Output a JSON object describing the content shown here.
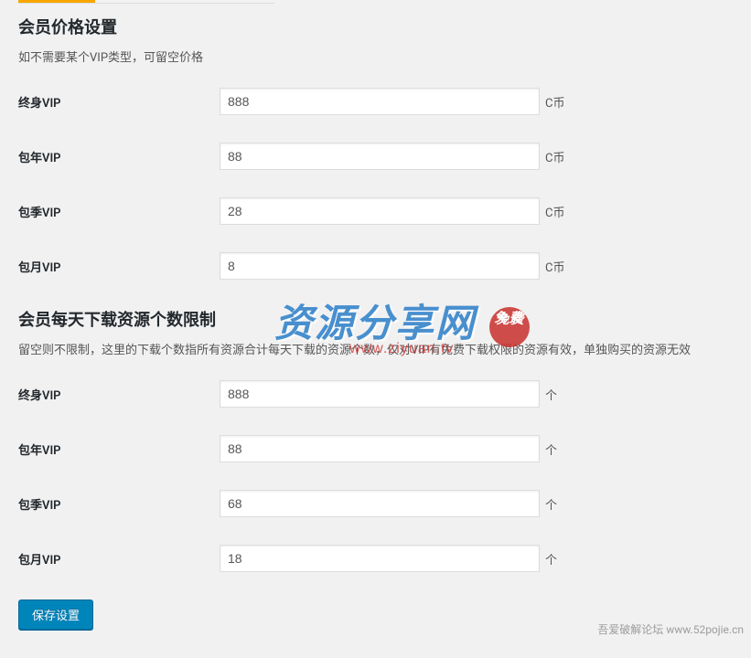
{
  "section1": {
    "title": "会员价格设置",
    "description": "如不需要某个VIP类型，可留空价格",
    "unit": "C币",
    "fields": [
      {
        "label": "终身VIP",
        "value": "888"
      },
      {
        "label": "包年VIP",
        "value": "88"
      },
      {
        "label": "包季VIP",
        "value": "28"
      },
      {
        "label": "包月VIP",
        "value": "8"
      }
    ]
  },
  "section2": {
    "title": "会员每天下载资源个数限制",
    "description": "留空则不限制，这里的下载个数指所有资源合计每天下载的资源个数，仅对VIP有免费下载权限的资源有效，单独购买的资源无效",
    "unit": "个",
    "fields": [
      {
        "label": "终身VIP",
        "value": "888"
      },
      {
        "label": "包年VIP",
        "value": "88"
      },
      {
        "label": "包季VIP",
        "value": "68"
      },
      {
        "label": "包月VIP",
        "value": "18"
      }
    ]
  },
  "submit": {
    "label": "保存设置"
  },
  "watermark": {
    "text": "资源分享网",
    "seal": "免费",
    "url": "www.ziyuan.tv"
  },
  "footer_badge": "吾爱破解论坛 www.52pojie.cn"
}
